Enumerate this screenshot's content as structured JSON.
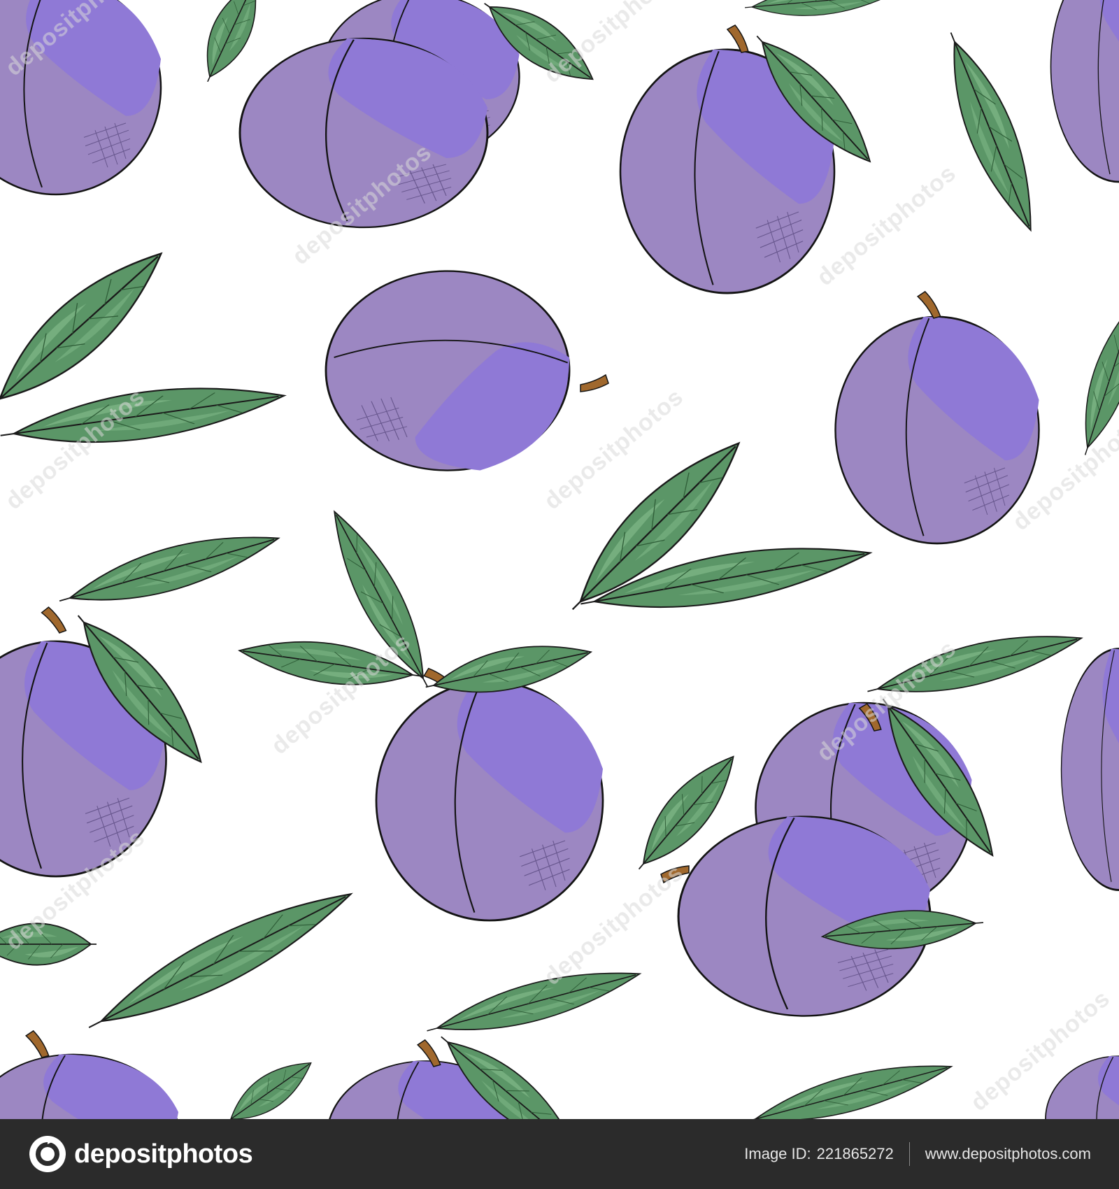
{
  "watermark": {
    "text": "depositphotos"
  },
  "footer": {
    "brand_name": "depositphotos",
    "image_id_label": "Image ID:",
    "image_id_value": "221865272",
    "site_url": "www.depositphotos.com"
  },
  "colors": {
    "plum_body": "#9c87c2",
    "plum_highlight": "#8f79d6",
    "leaf_fill": "#5b9667",
    "leaf_highlight": "#7db586",
    "stem": "#a0682d",
    "outline": "#111111",
    "footer_bg": "#2b2b2b"
  }
}
